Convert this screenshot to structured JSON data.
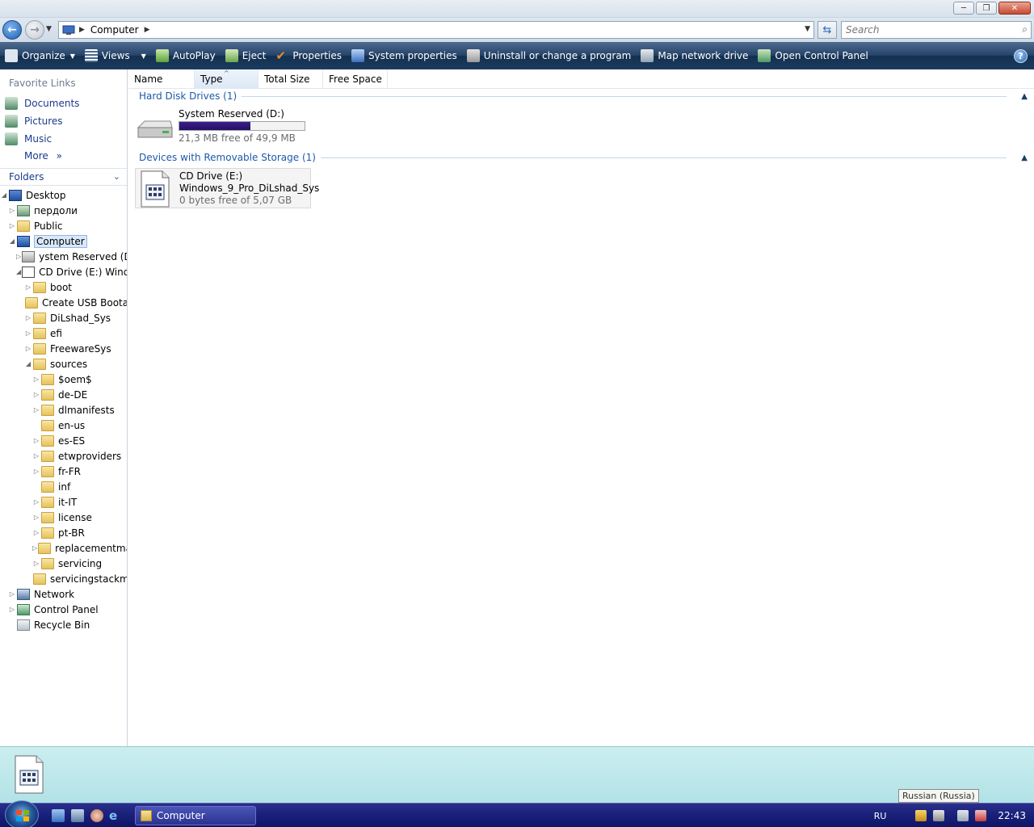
{
  "window": {
    "minimize": "─",
    "maximize": "❐",
    "close": "✕"
  },
  "address": {
    "crumb": "Computer",
    "search_placeholder": "Search"
  },
  "toolbar": {
    "organize": "Organize",
    "views": "Views",
    "autoplay": "AutoPlay",
    "eject": "Eject",
    "properties": "Properties",
    "system_properties": "System properties",
    "uninstall": "Uninstall or change a program",
    "map_drive": "Map network drive",
    "control_panel": "Open Control Panel",
    "help": "?"
  },
  "nav": {
    "favorites_title": "Favorite Links",
    "favorites": [
      "Documents",
      "Pictures",
      "Music"
    ],
    "more": "More",
    "more_arrow": "»",
    "folders_label": "Folders",
    "tree": [
      {
        "label": "Desktop",
        "level": 0,
        "tw": "◢",
        "icon": "desktop-icon"
      },
      {
        "label": "пердоли",
        "level": 1,
        "tw": "▷",
        "icon": "user-folder-icon"
      },
      {
        "label": "Public",
        "level": 1,
        "tw": "▷",
        "icon": "folder-icon"
      },
      {
        "label": "Computer",
        "level": 1,
        "tw": "◢",
        "icon": "computer-icon",
        "selected": true
      },
      {
        "label": "ystem Reserved (D:",
        "level": 2,
        "tw": "▷",
        "icon": "drive-icon"
      },
      {
        "label": "CD Drive (E:) Windo",
        "level": 2,
        "tw": "◢",
        "icon": "cd-drive-icon"
      },
      {
        "label": "boot",
        "level": 3,
        "tw": "▷",
        "icon": "folder-icon"
      },
      {
        "label": "Create USB Bootal",
        "level": 3,
        "tw": "",
        "icon": "folder-icon"
      },
      {
        "label": "DiLshad_Sys",
        "level": 3,
        "tw": "▷",
        "icon": "folder-icon"
      },
      {
        "label": "efi",
        "level": 3,
        "tw": "▷",
        "icon": "folder-icon"
      },
      {
        "label": "FreewareSys",
        "level": 3,
        "tw": "▷",
        "icon": "folder-icon"
      },
      {
        "label": "sources",
        "level": 3,
        "tw": "◢",
        "icon": "folder-icon"
      },
      {
        "label": "$oem$",
        "level": 4,
        "tw": "▷",
        "icon": "folder-icon"
      },
      {
        "label": "de-DE",
        "level": 4,
        "tw": "▷",
        "icon": "folder-icon"
      },
      {
        "label": "dlmanifests",
        "level": 4,
        "tw": "▷",
        "icon": "folder-icon"
      },
      {
        "label": "en-us",
        "level": 4,
        "tw": "",
        "icon": "folder-icon"
      },
      {
        "label": "es-ES",
        "level": 4,
        "tw": "▷",
        "icon": "folder-icon"
      },
      {
        "label": "etwproviders",
        "level": 4,
        "tw": "▷",
        "icon": "folder-icon"
      },
      {
        "label": "fr-FR",
        "level": 4,
        "tw": "▷",
        "icon": "folder-icon"
      },
      {
        "label": "inf",
        "level": 4,
        "tw": "",
        "icon": "folder-icon"
      },
      {
        "label": "it-IT",
        "level": 4,
        "tw": "▷",
        "icon": "folder-icon"
      },
      {
        "label": "license",
        "level": 4,
        "tw": "▷",
        "icon": "folder-icon"
      },
      {
        "label": "pt-BR",
        "level": 4,
        "tw": "▷",
        "icon": "folder-icon"
      },
      {
        "label": "replacementma",
        "level": 4,
        "tw": "▷",
        "icon": "folder-icon"
      },
      {
        "label": "servicing",
        "level": 4,
        "tw": "▷",
        "icon": "folder-icon"
      },
      {
        "label": "servicingstackm",
        "level": 4,
        "tw": "",
        "icon": "folder-icon"
      },
      {
        "label": "Network",
        "level": 1,
        "tw": "▷",
        "icon": "network-icon"
      },
      {
        "label": "Control Panel",
        "level": 1,
        "tw": "▷",
        "icon": "control-panel-icon"
      },
      {
        "label": "Recycle Bin",
        "level": 1,
        "tw": "",
        "icon": "recycle-bin-icon"
      }
    ]
  },
  "columns": {
    "name": "Name",
    "type": "Type",
    "total_size": "Total Size",
    "free_space": "Free Space",
    "sort_arrow": "^"
  },
  "groups": {
    "hdd": "Hard Disk Drives (1)",
    "removable": "Devices with Removable Storage (1)",
    "collapse_glyph": "▲"
  },
  "drives": {
    "system_reserved": {
      "name": "System Reserved (D:)",
      "free": "21,3 MB free of 49,9 MB",
      "used_fraction": 0.57
    },
    "cd": {
      "line1": "CD Drive (E:)",
      "line2": "Windows_9_Pro_DiLshad_Sys",
      "line3": "0 bytes free of 5,07 GB"
    }
  },
  "status": {
    "language_tooltip": "Russian (Russia)"
  },
  "taskbar": {
    "window_button": "Computer",
    "lang": "RU",
    "clock": "22:43"
  },
  "colors": {
    "accent": "#1c5aa8",
    "commandbar": "#1c3b60",
    "taskbar": "#19207a",
    "usage_bar": "#2e1575",
    "details_pane": "#c2e9ec"
  }
}
